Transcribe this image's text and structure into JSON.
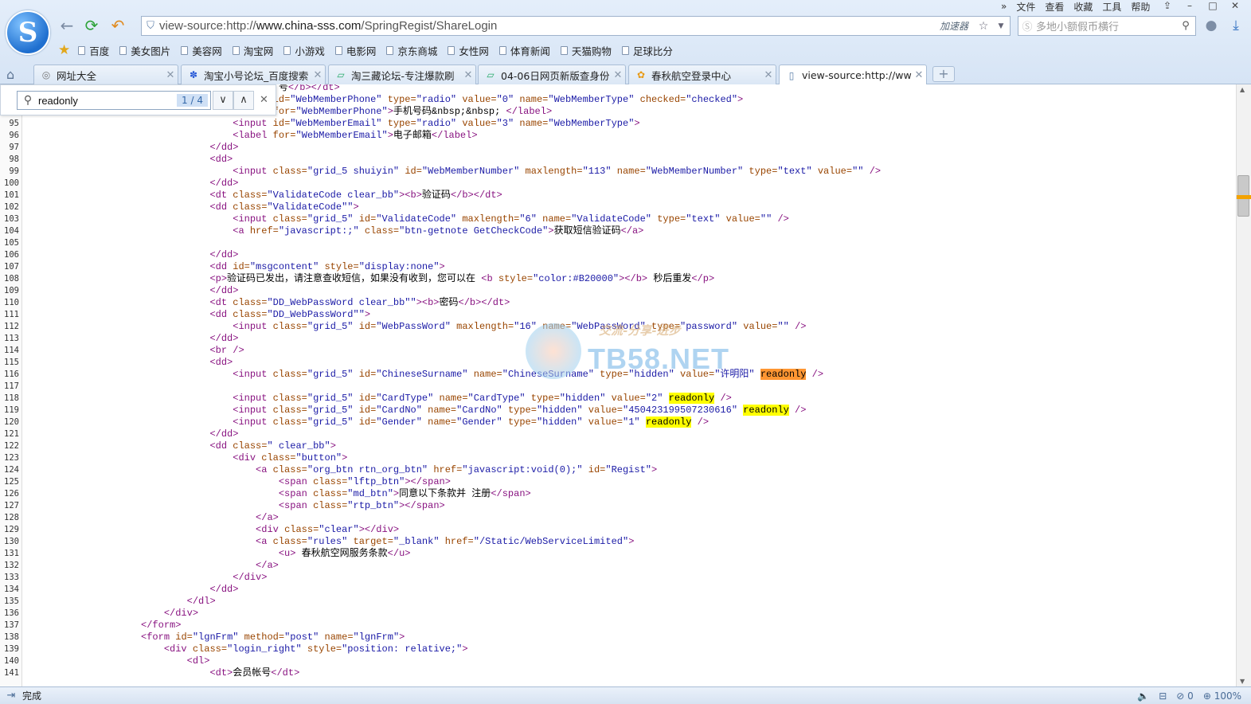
{
  "browser": {
    "menu": [
      "文件",
      "查看",
      "收藏",
      "工具",
      "帮助"
    ],
    "address": {
      "prefix": "view-source:http://",
      "host": "www.china-sss.com",
      "path": "/SpringRegist/ShareLogin"
    },
    "accelerator": "加速器",
    "search_placeholder": "多地小额假币横行",
    "bookmarks": [
      "百度",
      "美女图片",
      "美容网",
      "淘宝网",
      "小游戏",
      "电影网",
      "京东商城",
      "女性网",
      "体育新闻",
      "天猫购物",
      "足球比分"
    ],
    "tabs": [
      {
        "title": "网址大全",
        "icon": "globe-icon"
      },
      {
        "title": "淘宝小号论坛_百度搜索",
        "icon": "baidu-paw-icon"
      },
      {
        "title": "淘三藏论坛-专注爆款刷",
        "icon": "forum-icon"
      },
      {
        "title": "04-06日网页新版查身份",
        "icon": "forum-icon"
      },
      {
        "title": "春秋航空登录中心",
        "icon": "spring-airlines-icon"
      },
      {
        "title": "view-source:http://ww",
        "icon": "page-icon"
      }
    ],
    "status": "完成",
    "status_count": "0",
    "zoom": "100%"
  },
  "find": {
    "query": "readonly",
    "count": "1 / 4"
  },
  "code": {
    "l93": "号</b></dt>",
    "lines": [
      {
        "n": "94",
        "h": "<span class=\"tag\">&lt;input id=</span><span class=\"atv\">\"WebMemberPhone\"</span> <span class=\"atn\">type=</span><span class=\"atv\">\"radio\"</span> <span class=\"atn\">value=</span><span class=\"atv\">\"0\"</span> <span class=\"atn\">name=</span><span class=\"atv\">\"WebMemberType\"</span> <span class=\"atn\">checked=</span><span class=\"atv\">\"checked\"</span><span class=\"tag\">&gt;</span>"
      }
    ],
    "watermark_brand": "TB58.NET",
    "watermark_slogan": "交流-分享-进步"
  }
}
